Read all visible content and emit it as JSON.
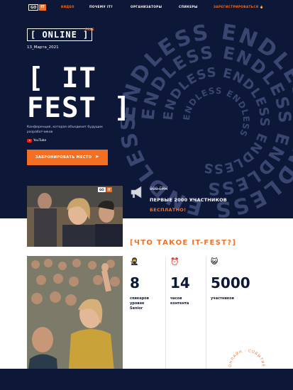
{
  "nav": {
    "logo_left": "GO",
    "logo_right": "IT",
    "links": [
      "ВИДЕО",
      "ПОЧЕМУ IT?",
      "ОРГАНИЗАТОРЫ",
      "СПИКЕРЫ"
    ],
    "register": "ЗАРЕГИСТРИРОВАТЬСЯ"
  },
  "hero": {
    "online": "[ ONLINE ]",
    "free_tag": "FREE",
    "date": "13_Марта_2021",
    "title_line1": "[ IT",
    "title_line2": "FEST ]",
    "description": "Конференция, которая объединит будущих разработчиков",
    "youtube": "YouTube",
    "cta": "ЗАБРОНИРОВАТЬ МЕСТО",
    "spiral_word": "ENDLESS"
  },
  "photo_badge": {
    "left": "GO",
    "right": "IT"
  },
  "offer": {
    "old_price": "900 ГРН",
    "first_participants": "ПЕРВЫЕ 2000 УЧАСТНИКОВ",
    "free": "БЕСПЛАТНО!"
  },
  "about": {
    "heading": "[ЧТО ТАКОЕ IT-FEST?]",
    "stats": [
      {
        "icon": "🥷",
        "value": "8",
        "label_lines": [
          "спикеров",
          "уровня",
          "Senior"
        ]
      },
      {
        "icon": "⏰",
        "value": "14",
        "label_lines": [
          "часов",
          "контента"
        ]
      },
      {
        "icon": "😺",
        "value": "5000",
        "label_lines": [
          "участников"
        ]
      }
    ],
    "circle_text": "ОНЛАЙН · СОБЫТИЕ ВЕСНЫ · 2021 ·"
  },
  "colors": {
    "navy": "#0d1738",
    "orange": "#f36f21",
    "white": "#ffffff"
  }
}
